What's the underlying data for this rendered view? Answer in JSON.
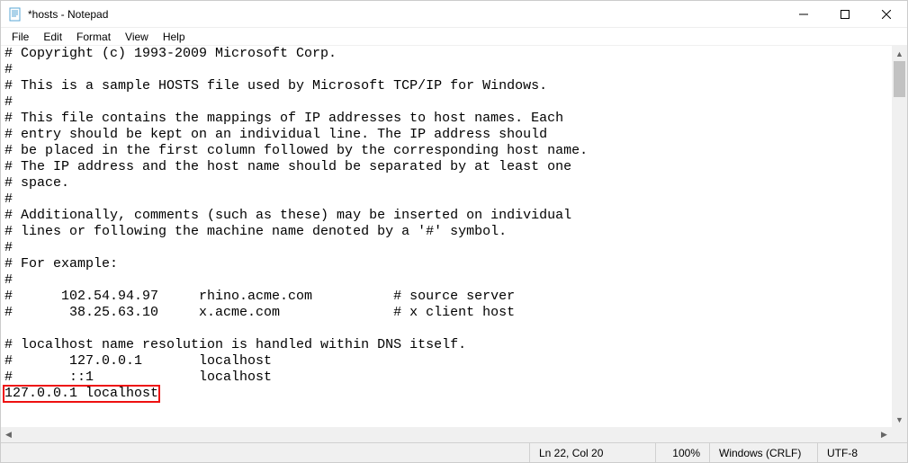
{
  "window": {
    "title": "*hosts - Notepad"
  },
  "menu": {
    "file": "File",
    "edit": "Edit",
    "format": "Format",
    "view": "View",
    "help": "Help"
  },
  "editor": {
    "content": "# Copyright (c) 1993-2009 Microsoft Corp.\n#\n# This is a sample HOSTS file used by Microsoft TCP/IP for Windows.\n#\n# This file contains the mappings of IP addresses to host names. Each\n# entry should be kept on an individual line. The IP address should\n# be placed in the first column followed by the corresponding host name.\n# The IP address and the host name should be separated by at least one\n# space.\n#\n# Additionally, comments (such as these) may be inserted on individual\n# lines or following the machine name denoted by a '#' symbol.\n#\n# For example:\n#\n#      102.54.94.97     rhino.acme.com          # source server\n#       38.25.63.10     x.acme.com              # x client host\n\n# localhost name resolution is handled within DNS itself.\n#       127.0.0.1       localhost\n#       ::1             localhost\n127.0.0.1 localhost"
  },
  "highlight": {
    "text": "127.0.0.1 localhost",
    "line_index": 21
  },
  "status": {
    "linecol": "Ln 22, Col 20",
    "zoom": "100%",
    "lineending": "Windows (CRLF)",
    "encoding": "UTF-8"
  }
}
